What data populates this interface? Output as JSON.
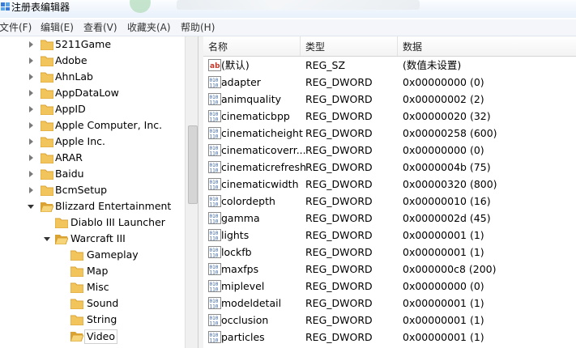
{
  "window": {
    "title": "注册表编辑器"
  },
  "menu": [
    "文件(F)",
    "编辑(E)",
    "查看(V)",
    "收藏夹(A)",
    "帮助(H)"
  ],
  "tree": {
    "items": [
      {
        "label": "5211Game",
        "expanded": false
      },
      {
        "label": "Adobe",
        "expanded": false
      },
      {
        "label": "AhnLab",
        "expanded": false
      },
      {
        "label": "AppDataLow",
        "expanded": false
      },
      {
        "label": "AppID",
        "expanded": false
      },
      {
        "label": "Apple Computer, Inc.",
        "expanded": false
      },
      {
        "label": "Apple Inc.",
        "expanded": false
      },
      {
        "label": "ARAR",
        "expanded": false
      },
      {
        "label": "Baidu",
        "expanded": false
      },
      {
        "label": "BcmSetup",
        "expanded": false
      },
      {
        "label": "Blizzard Entertainment",
        "expanded": true
      },
      {
        "label": "Diablo III Launcher",
        "expanded": false
      },
      {
        "label": "Warcraft III",
        "expanded": true
      },
      {
        "label": "Gameplay"
      },
      {
        "label": "Map"
      },
      {
        "label": "Misc"
      },
      {
        "label": "Sound"
      },
      {
        "label": "String"
      },
      {
        "label": "Video",
        "selected": true
      }
    ]
  },
  "list": {
    "headers": {
      "name": "名称",
      "type": "类型",
      "data": "数据"
    },
    "rows": [
      {
        "name": "(默认)",
        "type": "REG_SZ",
        "data": "(数值未设置)",
        "icon": "string-value-icon"
      },
      {
        "name": "adapter",
        "type": "REG_DWORD",
        "data": "0x00000000 (0)",
        "icon": "binary-value-icon"
      },
      {
        "name": "animquality",
        "type": "REG_DWORD",
        "data": "0x00000002 (2)",
        "icon": "binary-value-icon"
      },
      {
        "name": "cinematicbpp",
        "type": "REG_DWORD",
        "data": "0x00000020 (32)",
        "icon": "binary-value-icon"
      },
      {
        "name": "cinematicheight",
        "type": "REG_DWORD",
        "data": "0x00000258 (600)",
        "icon": "binary-value-icon"
      },
      {
        "name": "cinematicoverr...",
        "type": "REG_DWORD",
        "data": "0x00000000 (0)",
        "icon": "binary-value-icon"
      },
      {
        "name": "cinematicrefresh",
        "type": "REG_DWORD",
        "data": "0x0000004b (75)",
        "icon": "binary-value-icon"
      },
      {
        "name": "cinematicwidth",
        "type": "REG_DWORD",
        "data": "0x00000320 (800)",
        "icon": "binary-value-icon"
      },
      {
        "name": "colordepth",
        "type": "REG_DWORD",
        "data": "0x00000010 (16)",
        "icon": "binary-value-icon"
      },
      {
        "name": "gamma",
        "type": "REG_DWORD",
        "data": "0x0000002d (45)",
        "icon": "binary-value-icon"
      },
      {
        "name": "lights",
        "type": "REG_DWORD",
        "data": "0x00000001 (1)",
        "icon": "binary-value-icon"
      },
      {
        "name": "lockfb",
        "type": "REG_DWORD",
        "data": "0x00000001 (1)",
        "icon": "binary-value-icon"
      },
      {
        "name": "maxfps",
        "type": "REG_DWORD",
        "data": "0x000000c8 (200)",
        "icon": "binary-value-icon"
      },
      {
        "name": "miplevel",
        "type": "REG_DWORD",
        "data": "0x00000000 (0)",
        "icon": "binary-value-icon"
      },
      {
        "name": "modeldetail",
        "type": "REG_DWORD",
        "data": "0x00000001 (1)",
        "icon": "binary-value-icon"
      },
      {
        "name": "occlusion",
        "type": "REG_DWORD",
        "data": "0x00000001 (1)",
        "icon": "binary-value-icon"
      },
      {
        "name": "particles",
        "type": "REG_DWORD",
        "data": "0x00000001 (1)",
        "icon": "binary-value-icon"
      }
    ]
  },
  "colors": {
    "folder": "#f2c55c",
    "folder_dark": "#d9a233",
    "string_icon": "#c0392b",
    "binary_icon": "#2f5fa8"
  }
}
